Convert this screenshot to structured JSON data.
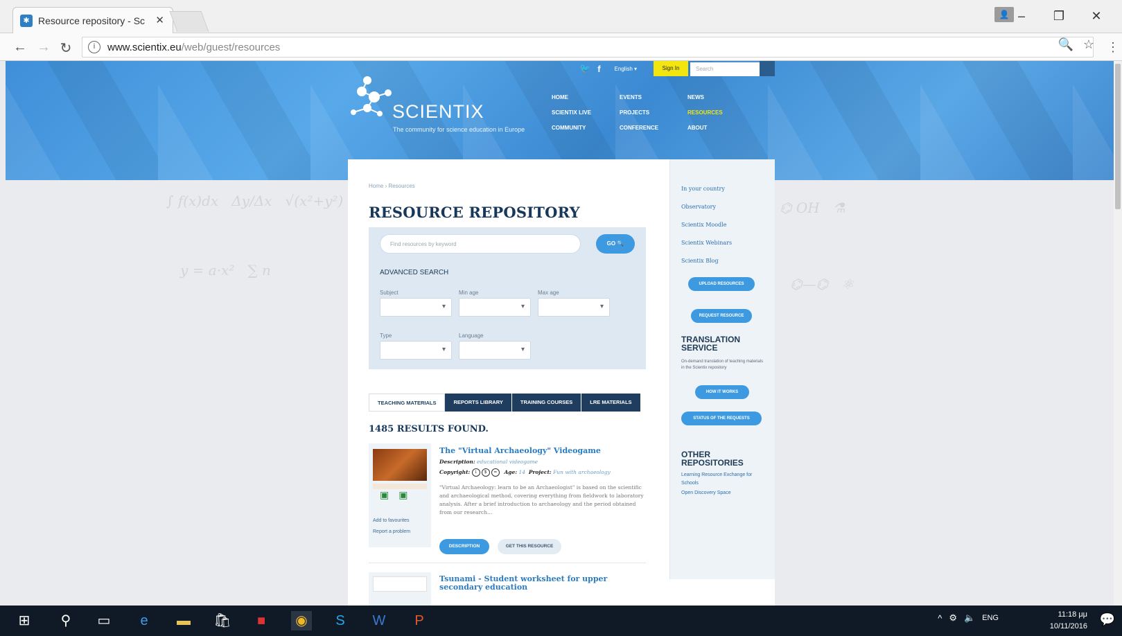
{
  "browser": {
    "tab_title": "Resource repository - Sc",
    "tab_close": "✕",
    "url_host": "www.scientix.eu",
    "url_path": "/web/guest/resources",
    "window_controls": [
      "–",
      "❐",
      "✕"
    ]
  },
  "site": {
    "logo_text": "SCIENTIX",
    "tagline": "The community for science education in Europe",
    "language": "English ▾",
    "sign_in": "Sign In",
    "search_placeholder": "Search",
    "nav": [
      "Home",
      "Events",
      "News",
      "Scientix Live",
      "Projects",
      "Resources",
      "Community",
      "Conference",
      "About"
    ],
    "active_nav": "Resources"
  },
  "content": {
    "breadcrumb": "Home › Resources",
    "title": "RESOURCE REPOSITORY",
    "keyword_placeholder": "Find resources by keyword",
    "go_label": "GO 🔍",
    "advanced_title": "ADVANCED SEARCH",
    "filters": {
      "subject": "Subject",
      "min_age": "Min age",
      "max_age": "Max age",
      "type": "Type",
      "language": "Language"
    },
    "tabs": [
      "Teaching materials",
      "Reports library",
      "Training courses",
      "LRE materials"
    ],
    "active_tab": "Teaching materials",
    "results_count": "1485 RESULTS FOUND.",
    "results": [
      {
        "title": "The \"Virtual Archaeology\" Videogame",
        "description_label": "Description:",
        "description_value": "educational videogame",
        "copyright_label": "Copyright:",
        "age_label": "Age:",
        "age_value": "14",
        "project_label": "Project:",
        "project_value": "Fun with archaeology",
        "text": "\"Virtual Archaeology: learn to be an Archaeologist\" is based on the scientific and archaeological method, covering everything from fieldwork to laboratory analysis. After a brief introduction to archaeology and the period obtained from our research...",
        "add_favourites": "Add to favourites",
        "report_problem": "Report a problem",
        "btn_description": "Description",
        "btn_get": "Get this resource"
      },
      {
        "title": "Tsunami - Student worksheet for upper secondary education"
      }
    ]
  },
  "sidebar": {
    "links": [
      "In your country",
      "Observatory",
      "Scientix Moodle",
      "Scientix Webinars",
      "Scientix Blog"
    ],
    "upload_button": "Upload resources",
    "request_button": "Request resource",
    "translation_title": "TRANSLATION SERVICE",
    "translation_text": "On-demand translation of teaching materials in the Scientix repository",
    "how_button": "How it works",
    "status_button": "Status of the requests",
    "other_title": "OTHER REPOSITORIES",
    "other_links": [
      "Learning Resource Exchange for Schools",
      "Open Discovery Space"
    ]
  },
  "taskbar": {
    "lang": "ENG",
    "time": "11:18 μμ",
    "date": "10/11/2016"
  },
  "colors": {
    "header_blue": "#4a9be0",
    "accent_yellow": "#f3e50e",
    "navy": "#1f3d5e",
    "button_blue": "#3d9ae0"
  }
}
